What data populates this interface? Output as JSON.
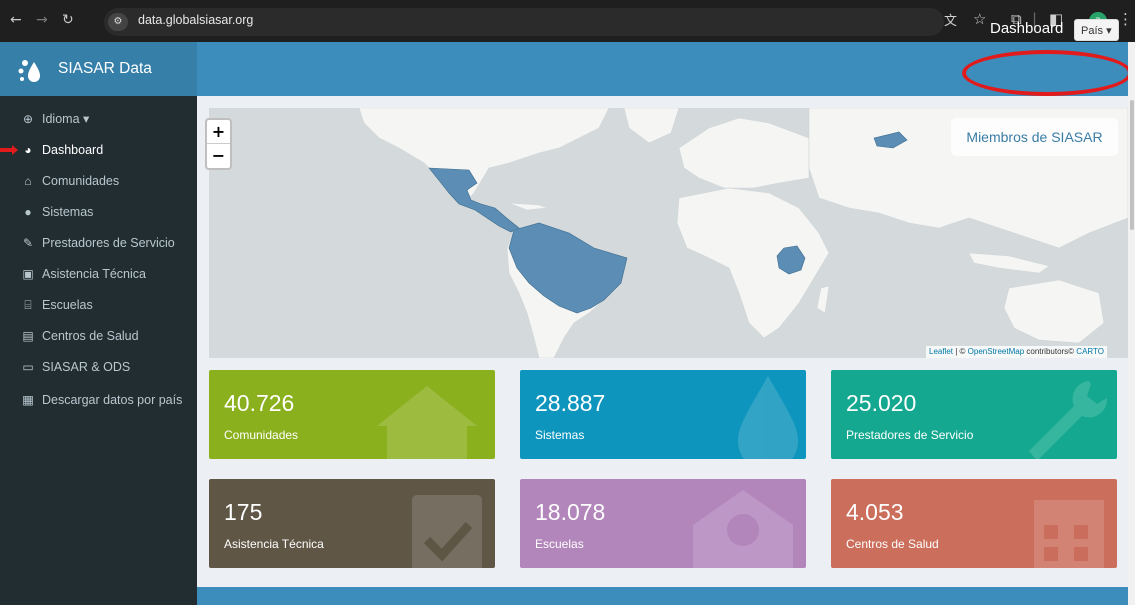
{
  "browser": {
    "url": "data.globalsiasar.org",
    "profile_initial": "a"
  },
  "header": {
    "app_title": "SIASAR Data",
    "dashboard_label": "Dashboard",
    "country_button": "País ▾"
  },
  "sidebar": {
    "items": [
      {
        "label": "Idioma ▾",
        "icon": "globe-icon"
      },
      {
        "label": "Dashboard",
        "icon": "pie-chart-icon",
        "active": true
      },
      {
        "label": "Comunidades",
        "icon": "home-icon"
      },
      {
        "label": "Sistemas",
        "icon": "drop-icon"
      },
      {
        "label": "Prestadores de Servicio",
        "icon": "wrench-icon"
      },
      {
        "label": "Asistencia Técnica",
        "icon": "clipboard-check-icon"
      },
      {
        "label": "Escuelas",
        "icon": "school-icon"
      },
      {
        "label": "Centros de Salud",
        "icon": "hospital-icon"
      },
      {
        "label": "SIASAR & ODS",
        "icon": "monitor-icon"
      },
      {
        "label": "Descargar datos por país",
        "icon": "file-icon"
      }
    ]
  },
  "map": {
    "title": "Miembros de SIASAR",
    "zoom_in": "+",
    "zoom_out": "−",
    "attribution_leaflet": "Leaflet",
    "attribution_sep": " | © ",
    "attribution_osm": "OpenStreetMap",
    "attribution_contrib": " contributors© ",
    "attribution_carto": "CARTO",
    "highlight_color": "#5b8db5"
  },
  "stats": [
    {
      "value": "40.726",
      "label": "Comunidades",
      "color": "#8bb01e",
      "icon": "home-icon"
    },
    {
      "value": "28.887",
      "label": "Sistemas",
      "color": "#0e95bd",
      "icon": "drop-icon"
    },
    {
      "value": "25.020",
      "label": "Prestadores de Servicio",
      "color": "#13a88f",
      "icon": "wrench-icon"
    },
    {
      "value": "175",
      "label": "Asistencia Técnica",
      "color": "#5f5646",
      "icon": "clipboard-check-icon"
    },
    {
      "value": "18.078",
      "label": "Escuelas",
      "color": "#b285bb",
      "icon": "school-icon"
    },
    {
      "value": "4.053",
      "label": "Centros de Salud",
      "color": "#cb6e5c",
      "icon": "hospital-icon"
    }
  ]
}
